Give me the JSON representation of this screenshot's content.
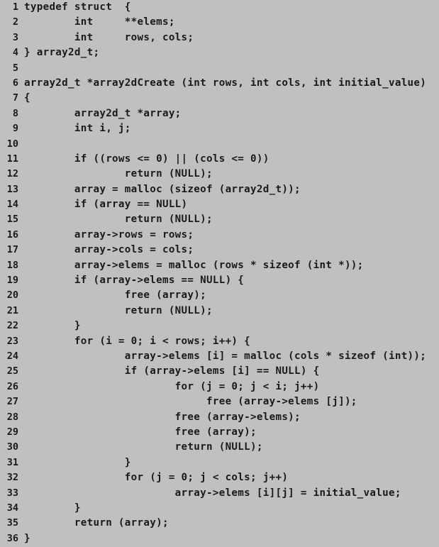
{
  "document": {
    "kind": "source-code-listing",
    "language": "C",
    "background_color": "#c0c0c0",
    "text_color": "#1a1a1a",
    "first_line_number": 1,
    "last_line_number": 36,
    "total_lines": 36,
    "right_edge_clipped": true
  },
  "lines": [
    {
      "number": "1",
      "text": "typedef struct  {"
    },
    {
      "number": "2",
      "text": "        int     **elems;"
    },
    {
      "number": "3",
      "text": "        int     rows, cols;"
    },
    {
      "number": "4",
      "text": "} array2d_t;"
    },
    {
      "number": "5",
      "text": ""
    },
    {
      "number": "6",
      "text": "array2d_t *array2dCreate (int rows, int cols, int initial_value)"
    },
    {
      "number": "7",
      "text": "{"
    },
    {
      "number": "8",
      "text": "        array2d_t *array;"
    },
    {
      "number": "9",
      "text": "        int i, j;"
    },
    {
      "number": "10",
      "text": ""
    },
    {
      "number": "11",
      "text": "        if ((rows <= 0) || (cols <= 0))"
    },
    {
      "number": "12",
      "text": "                return (NULL);"
    },
    {
      "number": "13",
      "text": "        array = malloc (sizeof (array2d_t));"
    },
    {
      "number": "14",
      "text": "        if (array == NULL)"
    },
    {
      "number": "15",
      "text": "                return (NULL);"
    },
    {
      "number": "16",
      "text": "        array->rows = rows;"
    },
    {
      "number": "17",
      "text": "        array->cols = cols;"
    },
    {
      "number": "18",
      "text": "        array->elems = malloc (rows * sizeof (int *));"
    },
    {
      "number": "19",
      "text": "        if (array->elems == NULL) {"
    },
    {
      "number": "20",
      "text": "                free (array);"
    },
    {
      "number": "21",
      "text": "                return (NULL);"
    },
    {
      "number": "22",
      "text": "        }"
    },
    {
      "number": "23",
      "text": "        for (i = 0; i < rows; i++) {"
    },
    {
      "number": "24",
      "text": "                array->elems [i] = malloc (cols * sizeof (int));"
    },
    {
      "number": "25",
      "text": "                if (array->elems [i] == NULL) {"
    },
    {
      "number": "26",
      "text": "                        for (j = 0; j < i; j++)"
    },
    {
      "number": "27",
      "text": "                             free (array->elems [j]);"
    },
    {
      "number": "28",
      "text": "                        free (array->elems);"
    },
    {
      "number": "29",
      "text": "                        free (array);"
    },
    {
      "number": "30",
      "text": "                        return (NULL);"
    },
    {
      "number": "31",
      "text": "                }"
    },
    {
      "number": "32",
      "text": "                for (j = 0; j < cols; j++)"
    },
    {
      "number": "33",
      "text": "                        array->elems [i][j] = initial_value;"
    },
    {
      "number": "34",
      "text": "        }"
    },
    {
      "number": "35",
      "text": "        return (array);"
    },
    {
      "number": "36",
      "text": "}"
    }
  ]
}
